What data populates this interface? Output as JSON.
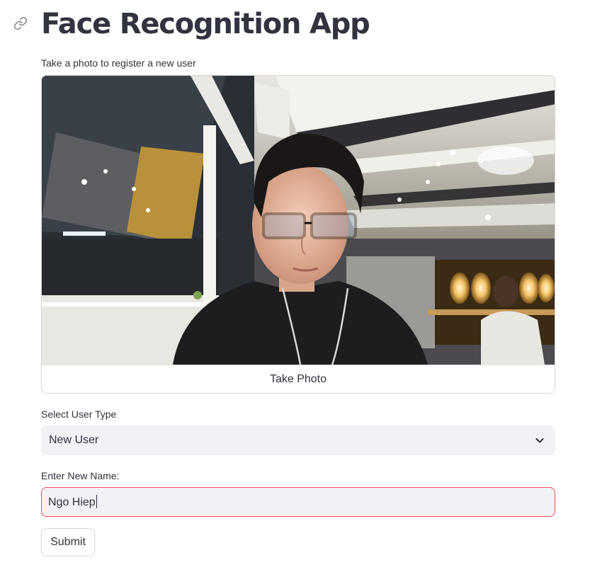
{
  "header": {
    "title": "Face Recognition App",
    "anchor_icon": "link-icon"
  },
  "camera": {
    "label": "Take a photo to register a new user",
    "take_photo_label": "Take Photo"
  },
  "user_type": {
    "label": "Select User Type",
    "selected": "New User",
    "icon": "chevron-down-icon"
  },
  "name_input": {
    "label": "Enter New Name:",
    "value": "Ngo Hiep",
    "border_color": "#ff4b4b"
  },
  "submit": {
    "label": "Submit"
  },
  "colors": {
    "text": "#31333f",
    "input_bg": "#f0f2f6",
    "focus_border": "#ff4b4b",
    "button_border": "#d6d6d9"
  }
}
